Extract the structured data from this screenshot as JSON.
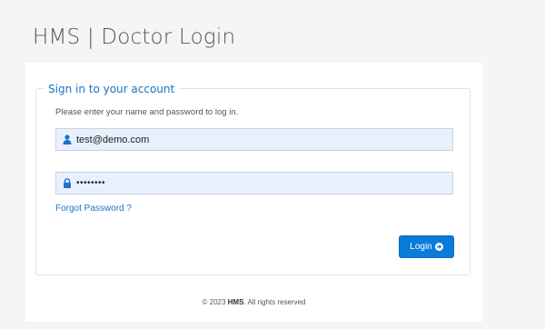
{
  "header": {
    "title": "HMS | Doctor Login"
  },
  "login_form": {
    "legend": "Sign in to your account",
    "instructions": "Please enter your name and password to log in.",
    "email": {
      "value": "test@demo.com",
      "icon": "user-icon"
    },
    "password": {
      "value": "demo1234",
      "icon": "lock-icon"
    },
    "forgot_password_label": "Forgot Password ?",
    "login_button": {
      "label": "Login",
      "icon": "arrow-circle-right-icon"
    }
  },
  "footer": {
    "prefix": "© 2023 ",
    "brand": "HMS",
    "suffix": ". All rights reserved"
  },
  "colors": {
    "accent": "#0a7bd8",
    "link": "#1a73c7",
    "input_background": "#e8f0fe",
    "page_background": "#f5f5f5"
  }
}
